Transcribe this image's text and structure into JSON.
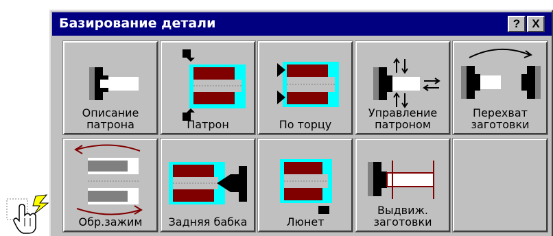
{
  "window": {
    "title": "Базирование детали",
    "help_label": "?",
    "close_label": "X"
  },
  "buttons": [
    {
      "label": "Описание\nпатрона",
      "icon": "chuck-description-icon"
    },
    {
      "label": "Патрон",
      "icon": "chuck-icon"
    },
    {
      "label": "По торцу",
      "icon": "face-locate-icon"
    },
    {
      "label": "Управление\nпатроном",
      "icon": "chuck-control-icon"
    },
    {
      "label": "Перехват\nзаготовки",
      "icon": "workpiece-regrip-icon"
    },
    {
      "label": "Обр.зажим",
      "icon": "reverse-clamp-icon"
    },
    {
      "label": "Задняя бабка",
      "icon": "tailstock-icon"
    },
    {
      "label": "Люнет",
      "icon": "steady-rest-icon"
    },
    {
      "label": "Выдвиж.\nзаготовки",
      "icon": "workpiece-extension-icon"
    }
  ],
  "colors": {
    "workpiece": "#800000",
    "jaw_highlight": "#00ffff",
    "title_bar": "#000080",
    "arrow": "#800000"
  }
}
